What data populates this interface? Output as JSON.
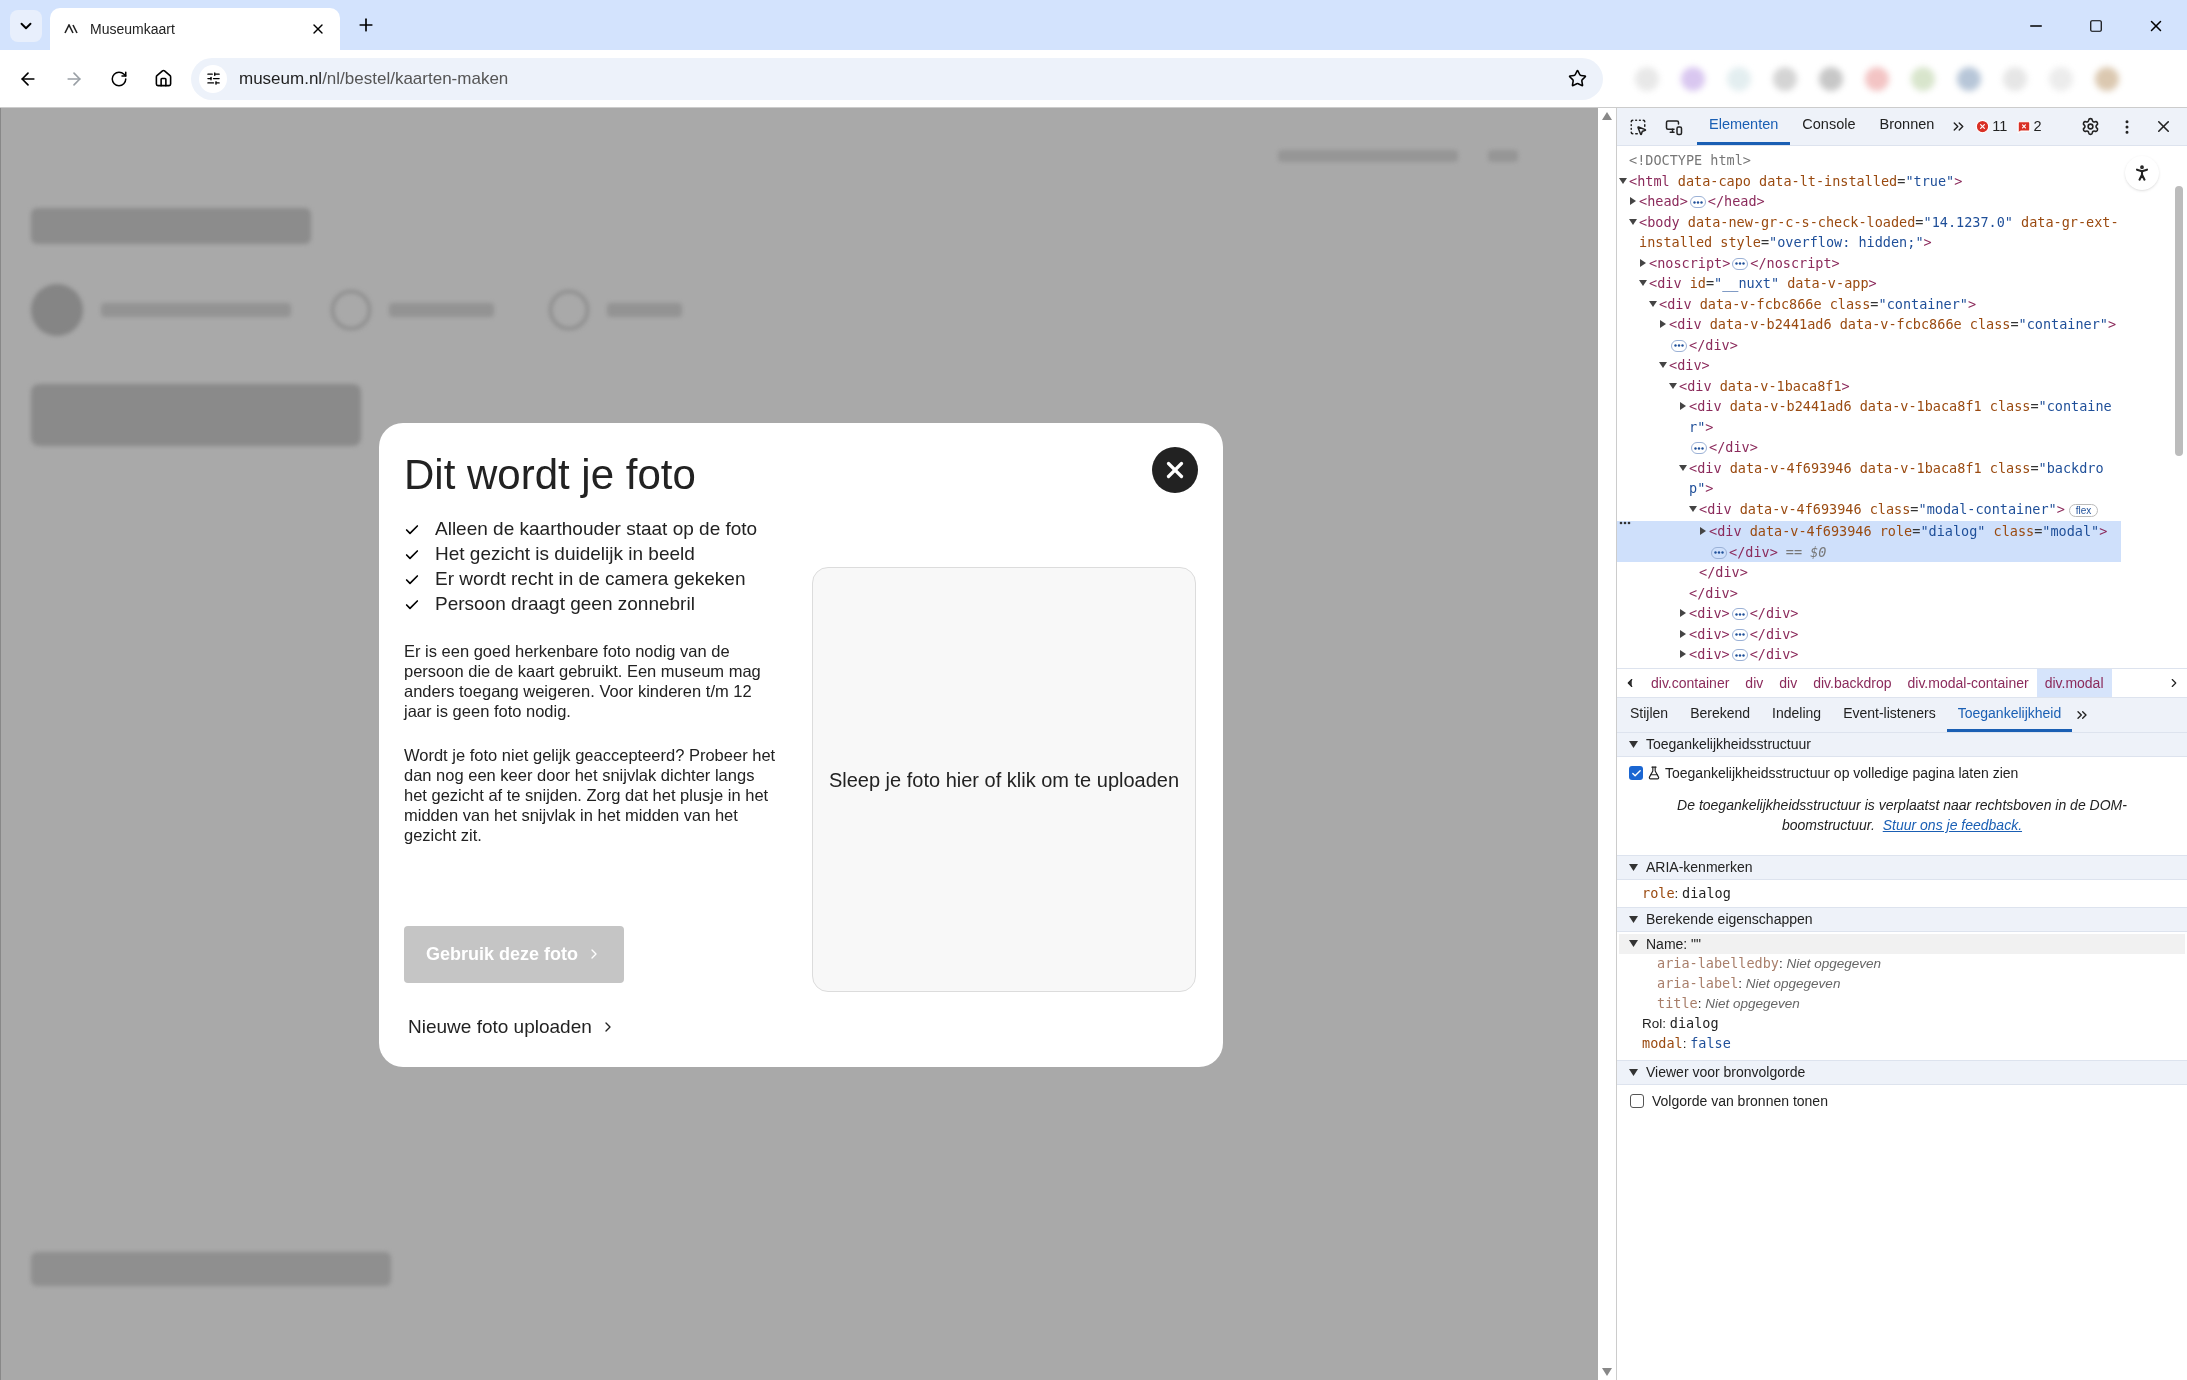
{
  "browser": {
    "tab": {
      "title": "Museumkaart",
      "selected": true
    },
    "url_host": "museum.nl",
    "url_path": "/nl/bestel/kaarten-maken"
  },
  "modal": {
    "title": "Dit wordt je foto",
    "checklist": [
      "Alleen de kaarthouder staat op de foto",
      "Het gezicht is duidelijk in beeld",
      "Er wordt recht in de camera gekeken",
      "Persoon draagt geen zonnebril"
    ],
    "paragraphs": [
      "Er is een goed herkenbare foto nodig van de persoon die de kaart gebruikt. Een museum mag anders toegang weigeren. Voor kinderen t/m 12 jaar is geen foto nodig.",
      "Wordt je foto niet gelijk geaccepteerd? Probeer het dan nog een keer door het snijvlak dichter langs het gezicht af te snijden. Zorg dat het plusje in het midden van het snijvlak in het midden van het gezicht zit."
    ],
    "primary_button": {
      "label": "Gebruik deze foto",
      "disabled": true
    },
    "link": "Nieuwe foto uploaden",
    "dropzone": "Sleep je foto hier of klik om te uploaden"
  },
  "devtools": {
    "tabs": [
      {
        "label": "Elementen",
        "selected": true
      },
      {
        "label": "Console",
        "selected": false
      },
      {
        "label": "Bronnen",
        "selected": false
      }
    ],
    "errors": "11",
    "warnings": "2",
    "dom": [
      {
        "open": "<!DOCTYPE html>",
        "kind": "doctype"
      },
      {
        "open": "<html data-capo data-lt-installed=\"true\">",
        "expanded": true,
        "children": [
          {
            "open": "<head>",
            "close": "</head>",
            "expanded": false
          },
          {
            "open": "<body data-new-gr-c-s-check-loaded=\"14.1237.0\" data-gr-ext-installed style=\"overflow: hidden;\">",
            "expanded": true,
            "children": [
              {
                "open": "<noscript>",
                "close": "</noscript>",
                "expanded": false
              },
              {
                "open": "<div id=\"__nuxt\" data-v-app>",
                "expanded": true,
                "children": [
                  {
                    "open": "<div data-v-fcbc866e class=\"container\">",
                    "expanded": true,
                    "children": [
                      {
                        "open": "<div data-v-b2441ad6 data-v-fcbc866e class=\"container\">",
                        "close": "</div>",
                        "expanded": false
                      },
                      {
                        "open": "<div>",
                        "expanded": true,
                        "children": [
                          {
                            "open": "<div data-v-1baca8f1>",
                            "expanded": true,
                            "children": [
                              {
                                "open": "<div data-v-b2441ad6 data-v-1baca8f1 class=\"container\">",
                                "close": "</div>",
                                "expanded": false
                              },
                              {
                                "open": "<div data-v-4f693946 data-v-1baca8f1 class=\"backdrop\">",
                                "close": "</div>",
                                "expanded": true,
                                "children": [
                                  {
                                    "open": "<div data-v-4f693946 class=\"modal-container\">",
                                    "close": "</div>",
                                    "badge": "flex",
                                    "expanded": true,
                                    "children": [
                                      {
                                        "open": "<div data-v-4f693946 role=\"dialog\" class=\"modal\">",
                                        "close": "</div>",
                                        "suffix": "== $0",
                                        "expanded": false,
                                        "selected": true
                                      }
                                    ]
                                  }
                                ]
                              },
                              {
                                "open": "<div>",
                                "close": "</div>",
                                "expanded": false
                              },
                              {
                                "open": "<div>",
                                "close": "</div>",
                                "expanded": false
                              },
                              {
                                "open": "<div>",
                                "close": "</div>",
                                "expanded": false
                              }
                            ]
                          }
                        ]
                      }
                    ]
                  }
                ]
              }
            ]
          }
        ]
      }
    ],
    "breadcrumbs": [
      {
        "label": "div.container",
        "selected": false
      },
      {
        "label": "div",
        "selected": false
      },
      {
        "label": "div",
        "selected": false
      },
      {
        "label": "div.backdrop",
        "selected": false
      },
      {
        "label": "div.modal-container",
        "selected": false
      },
      {
        "label": "div.modal",
        "selected": true
      }
    ],
    "subtabs": [
      {
        "label": "Stijlen",
        "selected": false
      },
      {
        "label": "Berekend",
        "selected": false
      },
      {
        "label": "Indeling",
        "selected": false
      },
      {
        "label": "Event-listeners",
        "selected": false
      },
      {
        "label": "Toegankelijkheid",
        "selected": true
      }
    ],
    "a11y": {
      "tree_section": "Toegankelijkheidsstructuur",
      "tree_option": {
        "label": "Toegankelijkheidsstructuur op volledige pagina laten zien",
        "checked": true
      },
      "notice": "De toegankelijkheidsstructuur is verplaatst naar rechtsboven in de DOM-boomstructuur.",
      "feedback_link": "Stuur ons je feedback.",
      "aria_section": "ARIA-kenmerken",
      "aria": [
        {
          "key": "role",
          "sep": ":",
          "value": "dialog"
        }
      ],
      "computed_section": "Berekende eigenschappen",
      "name_row": "Name: \"\"",
      "name_sources": [
        {
          "key": "aria-labelledby",
          "sep": ":",
          "value": "Niet opgegeven"
        },
        {
          "key": "aria-label",
          "sep": ":",
          "value": "Niet opgegeven"
        },
        {
          "key": "title",
          "sep": ":",
          "value": "Niet opgegeven"
        }
      ],
      "role_row": {
        "key": "Rol",
        "sep": ":",
        "value": "dialog"
      },
      "modal_row": {
        "key": "modal",
        "sep": ":",
        "value": "false"
      },
      "source_section": "Viewer voor bronvolgorde",
      "source_option": {
        "label": "Volgorde van bronnen tonen",
        "checked": false
      }
    }
  }
}
